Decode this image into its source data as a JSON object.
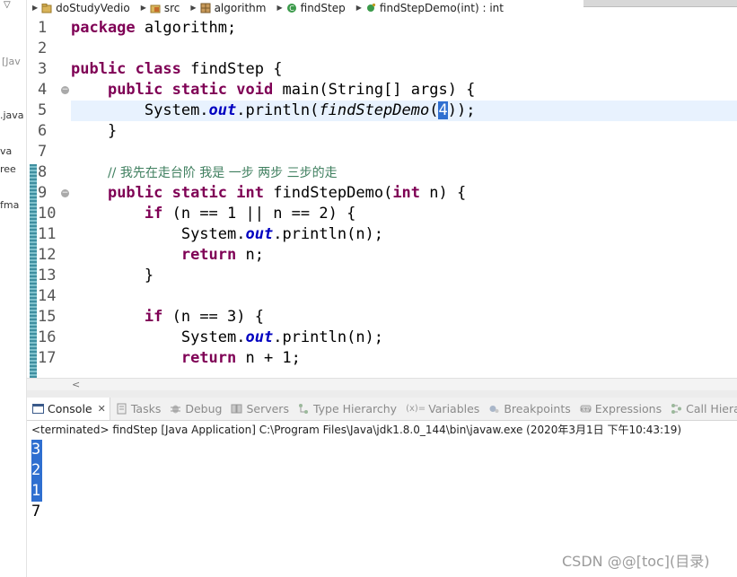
{
  "breadcrumb": [
    {
      "label": "doStudyVedio",
      "icon": "project-icon"
    },
    {
      "label": "src",
      "icon": "source-folder-icon"
    },
    {
      "label": "algorithm",
      "icon": "package-icon"
    },
    {
      "label": "findStep",
      "icon": "class-icon"
    },
    {
      "label": "findStepDemo(int) : int",
      "icon": "method-icon"
    }
  ],
  "explorer_fragments": [
    "[Jav",
    ".java",
    "va",
    "ree",
    "fma"
  ],
  "editor": {
    "line_numbers": [
      "1",
      "2",
      "3",
      "4",
      "5",
      "6",
      "7",
      "8",
      "9",
      "10",
      "11",
      "12",
      "13",
      "14",
      "15",
      "16",
      "17"
    ],
    "lines": {
      "l1_kw": "package",
      "l1_rest": " algorithm;",
      "l3_kw1": "public",
      "l3_kw2": "class",
      "l3_rest": " findStep {",
      "l4_kw1": "public",
      "l4_kw2": "static",
      "l4_kw3": "void",
      "l4_rest": " main(String[] args) {",
      "l5_a": "System.",
      "l5_out": "out",
      "l5_b": ".println(",
      "l5_call": "findStepDemo",
      "l5_c": "(",
      "l5_arg": "4",
      "l5_d": "));",
      "l6": "}",
      "l8_comment": "// 我先在走台阶 我是 一步 两步 三步的走",
      "l9_kw1": "public",
      "l9_kw2": "static",
      "l9_kw3": "int",
      "l9_rest1": " findStepDemo(",
      "l9_kw4": "int",
      "l9_rest2": " n) {",
      "l10_kw": "if",
      "l10_rest": " (n == 1 || n == 2) {",
      "l11_a": "System.",
      "l11_out": "out",
      "l11_b": ".println(n);",
      "l12_kw": "return",
      "l12_rest": " n;",
      "l13": "}",
      "l15_kw": "if",
      "l15_rest": " (n == 3) {",
      "l16_a": "System.",
      "l16_out": "out",
      "l16_b": ".println(n);",
      "l17_kw": "return",
      "l17_rest": " n + 1;"
    }
  },
  "console": {
    "tabs": [
      {
        "label": "Console",
        "icon": "console-icon",
        "active": true
      },
      {
        "label": "Tasks",
        "icon": "tasks-icon"
      },
      {
        "label": "Debug",
        "icon": "debug-icon"
      },
      {
        "label": "Servers",
        "icon": "servers-icon"
      },
      {
        "label": "Type Hierarchy",
        "icon": "type-hierarchy-icon"
      },
      {
        "label": "Variables",
        "icon": "variables-icon",
        "prefix": "(x)="
      },
      {
        "label": "Breakpoints",
        "icon": "breakpoints-icon"
      },
      {
        "label": "Expressions",
        "icon": "expressions-icon"
      },
      {
        "label": "Call Hierarch",
        "icon": "call-hierarchy-icon"
      }
    ],
    "close_glyph": "✕",
    "status": "<terminated> findStep [Java Application] C:\\Program Files\\Java\\jdk1.8.0_144\\bin\\javaw.exe (2020年3月1日 下午10:43:19)",
    "output": [
      "3",
      "2",
      "1",
      "7"
    ]
  },
  "watermark": "CSDN @@[toc](目录)",
  "colors": {
    "keyword": "#7f0055",
    "field": "#0000c0",
    "comment": "#3f7f5f",
    "selection": "#2f6fd0",
    "current_line": "#e8f2fe"
  }
}
